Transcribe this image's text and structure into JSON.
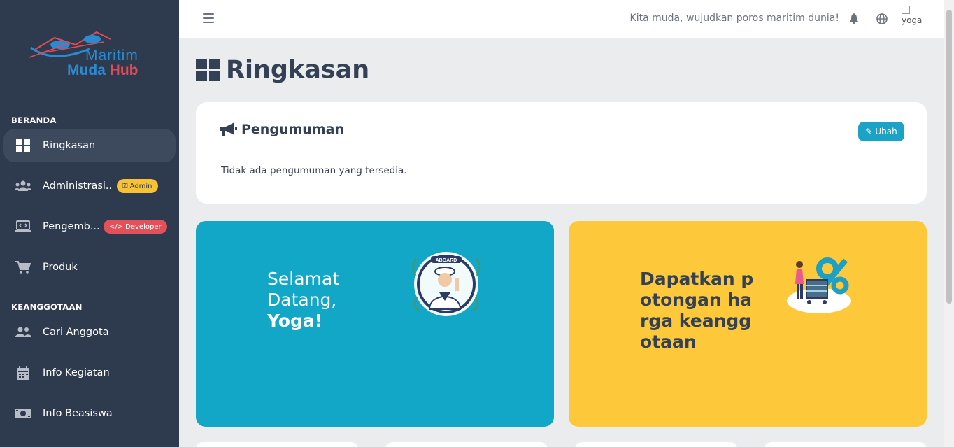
{
  "app": {
    "logo_line1": "Maritim",
    "logo_line2a": "Muda",
    "logo_line2b": "Hub"
  },
  "sidebar": {
    "section_home": "BERANDA",
    "section_membership": "KEANGGOTAAN",
    "items": [
      {
        "label": "Ringkasan",
        "icon": "grid-icon",
        "active": true
      },
      {
        "label": "Administrasi...",
        "icon": "users-icon",
        "badge": "Admin"
      },
      {
        "label": "Pengemb...",
        "icon": "laptop-code-icon",
        "badge": "Developer"
      },
      {
        "label": "Produk",
        "icon": "cart-icon"
      },
      {
        "label": "Cari Anggota",
        "icon": "user-friends-icon"
      },
      {
        "label": "Info Kegiatan",
        "icon": "calendar-icon"
      },
      {
        "label": "Info Beasiswa",
        "icon": "money-icon"
      }
    ]
  },
  "topbar": {
    "tagline": "Kita muda, wujudkan poros maritim dunia!",
    "avatar_alt": "yoga"
  },
  "main": {
    "title": "Ringkasan",
    "announcement": {
      "title": "Pengumuman",
      "edit_label": "Ubah",
      "empty_text": "Tidak ada pengumuman yang tersedia."
    },
    "welcome": {
      "line1": "Selamat",
      "line2": "Datang,",
      "name": "Yoga!",
      "badge_text": "ABOARD"
    },
    "promo": {
      "text": "Dapatkan potongan harga keanggotaan"
    }
  },
  "colors": {
    "sidebar_bg": "#2e3a4e",
    "welcome_bg": "#12a7c7",
    "promo_bg": "#fdc83a",
    "accent": "#1aa3c6",
    "admin_badge": "#f7c335",
    "developer_badge": "#e2505a"
  }
}
